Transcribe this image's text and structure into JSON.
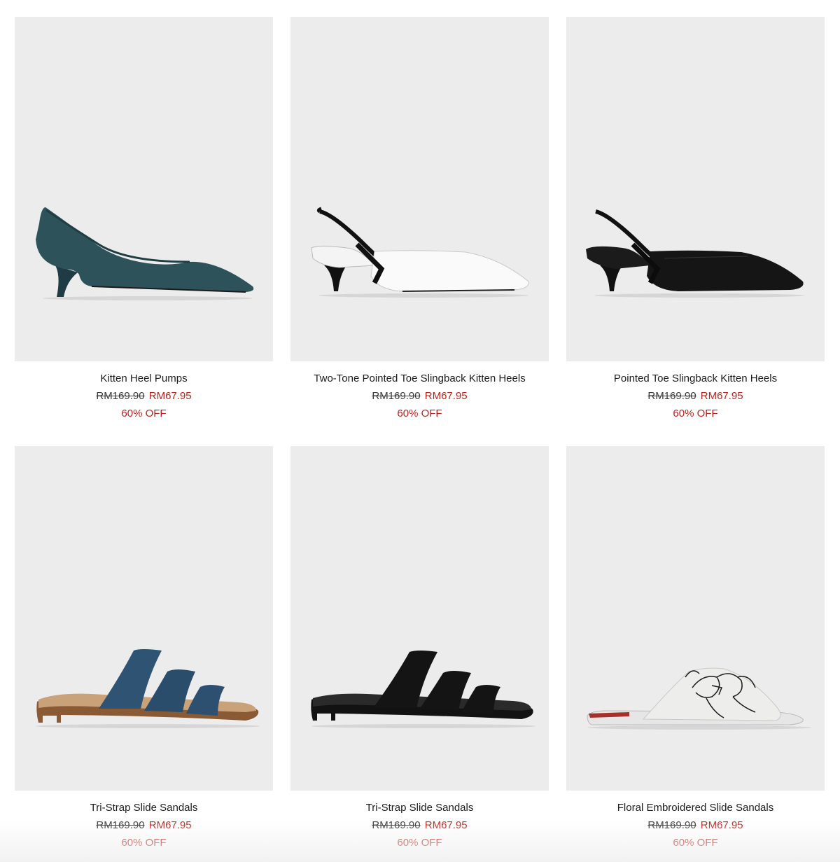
{
  "products": [
    {
      "name": "Kitten Heel Pumps",
      "original_price": "RM169.90",
      "sale_price": "RM67.95",
      "discount": "60% OFF",
      "image_icon": "teal-pump-shoe"
    },
    {
      "name": "Two-Tone Pointed Toe Slingback Kitten Heels",
      "original_price": "RM169.90",
      "sale_price": "RM67.95",
      "discount": "60% OFF",
      "image_icon": "white-slingback-shoe"
    },
    {
      "name": "Pointed Toe Slingback Kitten Heels",
      "original_price": "RM169.90",
      "sale_price": "RM67.95",
      "discount": "60% OFF",
      "image_icon": "black-slingback-shoe"
    },
    {
      "name": "Tri-Strap Slide Sandals",
      "original_price": "RM169.90",
      "sale_price": "RM67.95",
      "discount": "60% OFF",
      "image_icon": "blue-strap-sandal"
    },
    {
      "name": "Tri-Strap Slide Sandals",
      "original_price": "RM169.90",
      "sale_price": "RM67.95",
      "discount": "60% OFF",
      "image_icon": "black-strap-sandal"
    },
    {
      "name": "Floral Embroidered Slide Sandals",
      "original_price": "RM169.90",
      "sale_price": "RM67.95",
      "discount": "60% OFF",
      "image_icon": "floral-slide-sandal"
    }
  ],
  "colors": {
    "image_bg": "#ececed",
    "sale": "#b8241c",
    "text": "#1c1c1c"
  }
}
